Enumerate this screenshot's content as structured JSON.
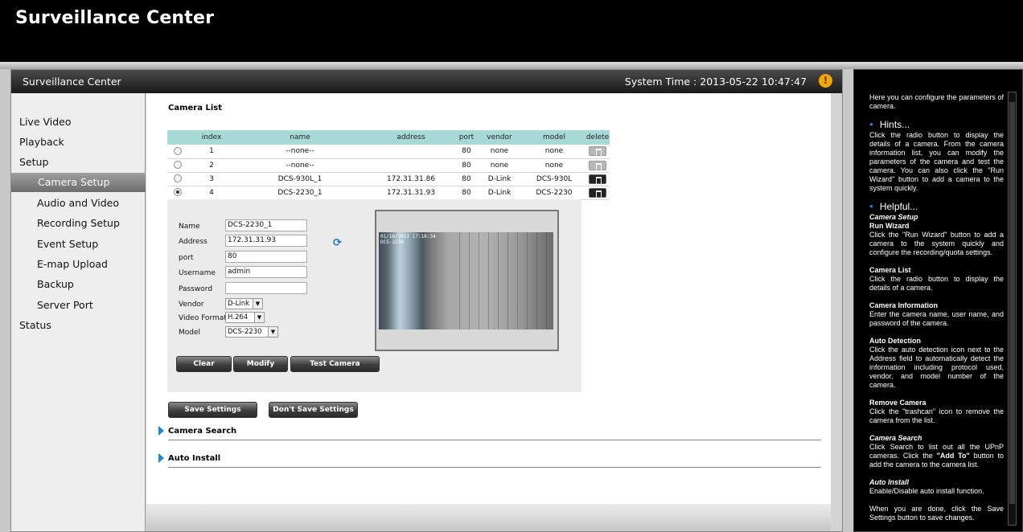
{
  "topbar": {
    "title": "Surveillance Center"
  },
  "panel": {
    "title": "Surveillance Center",
    "system_time": "System Time : 2013-05-22 10:47:47",
    "alert_icon": "!"
  },
  "sidebar": {
    "items": [
      {
        "label": "Live Video"
      },
      {
        "label": "Playback"
      },
      {
        "label": "Setup"
      },
      {
        "label": "Camera Setup"
      },
      {
        "label": "Audio and Video"
      },
      {
        "label": "Recording Setup"
      },
      {
        "label": "Event Setup"
      },
      {
        "label": "E-map Upload"
      },
      {
        "label": "Backup"
      },
      {
        "label": "Server Port"
      },
      {
        "label": "Status"
      }
    ]
  },
  "camera_list": {
    "title": "Camera List",
    "headers": [
      "index",
      "name",
      "address",
      "port",
      "vendor",
      "model",
      "delete"
    ],
    "rows": [
      {
        "index": "1",
        "name": "--none--",
        "address": "",
        "port": "80",
        "vendor": "none",
        "model": "none"
      },
      {
        "index": "2",
        "name": "--none--",
        "address": "",
        "port": "80",
        "vendor": "none",
        "model": "none"
      },
      {
        "index": "3",
        "name": "DCS-930L_1",
        "address": "172.31.31.86",
        "port": "80",
        "vendor": "D-Link",
        "model": "DCS-930L"
      },
      {
        "index": "4",
        "name": "DCS-2230_1",
        "address": "172.31.31.93",
        "port": "80",
        "vendor": "D-Link",
        "model": "DCS-2230"
      }
    ]
  },
  "form": {
    "name_label": "Name",
    "name_value": "DCS-2230_1",
    "address_label": "Address",
    "address_value": "172.31.31.93",
    "port_label": "port",
    "port_value": "80",
    "username_label": "Username",
    "username_value": "admin",
    "password_label": "Password",
    "password_value": "",
    "vendor_label": "Vendor",
    "vendor_value": "D-Link",
    "format_label": "Video Format",
    "format_value": "H.264",
    "model_label": "Model",
    "model_value": "DCS-2230",
    "clear": "Clear",
    "modify": "Modify",
    "test": "Test Camera"
  },
  "preview": {
    "stamp": "01/16/2011 17:18:34\nDCS-2230"
  },
  "actions": {
    "save": "Save Settings",
    "dont_save": "Don't Save Settings"
  },
  "sections": {
    "camera_search": "Camera Search",
    "auto_install": "Auto Install"
  },
  "help": {
    "intro": "Here you can configure the parameters of camera.",
    "hints_title": "Hints...",
    "hints_text": "Click the radio button to display the details of a camera. From the camera information list, you can modify the parameters of the camera and test the camera. You can also click the \"Run Wizard\" button to add a camera to the system quickly.",
    "helpful_title": "Helpful...",
    "cs_title": "Camera Setup",
    "rw_title": "Run Wizard",
    "rw_text": "Click the \"Run Wizard\" button to add a camera to the system quickly and configure the recording/quota settings.",
    "cl_title": "Camera List",
    "cl_text": "Click the radio button to display the details of a camera.",
    "ci_title": "Camera Information",
    "ci_text": "Enter the camera name, user name, and password of the camera.",
    "ad_title": "Auto Detection",
    "ad_text": "Click the auto detection icon next to the Address field to automatically detect the information including protocol used, vendor, and model number of the camera.",
    "rc_title": "Remove Camera",
    "rc_text": "Click the \"trashcan\" icon to remove the camera from the list.",
    "csr_title": "Camera Search",
    "csr_text_a": "Click Search to list out all the UPnP cameras. Click the ",
    "csr_text_b": "\"Add To\"",
    "csr_text_c": " button to add the camera to the camera list.",
    "ai_title": "Auto Install",
    "ai_text": "Enable/Disable auto install function.",
    "cut_text": "When you are done, click the Save Settings button to save changes."
  },
  "colors": {
    "table_header": "#a7dad6",
    "accent": "#1a88d8",
    "alert": "#f0a800"
  }
}
